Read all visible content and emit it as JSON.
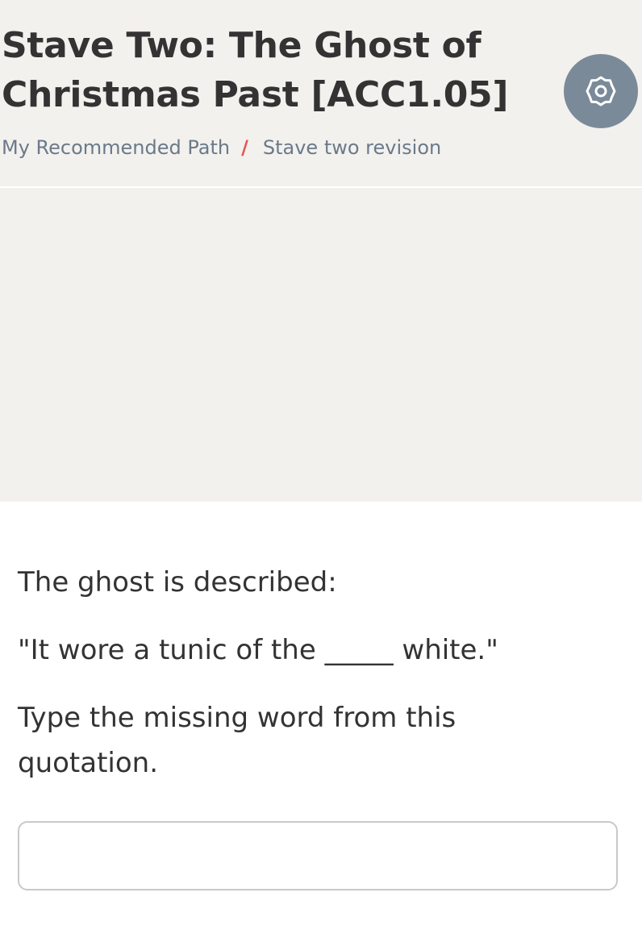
{
  "header": {
    "title": "Stave Two: The Ghost of Christmas Past [ACC1.05]",
    "settings_icon": "gear-icon",
    "background_color": "#f3f1ee",
    "settings_button_color": "#7a8a99"
  },
  "breadcrumb": {
    "parent": "My Recommended Path",
    "separator": "/",
    "current": "Stave two revision",
    "separator_color": "#e2574c"
  },
  "question": {
    "intro": "The ghost is described:",
    "quote": "\"It wore a tunic of the _____ white.\"",
    "instruction": "Type the missing word from this quotation."
  },
  "answer": {
    "value": "",
    "placeholder": ""
  }
}
